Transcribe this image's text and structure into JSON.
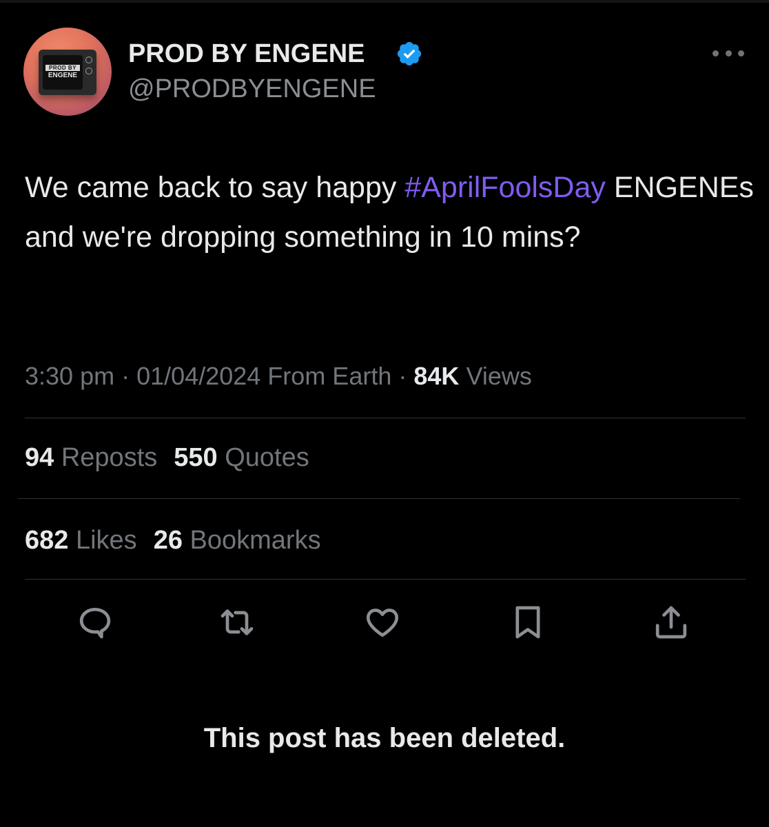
{
  "author": {
    "display_name": "PROD BY ENGENE",
    "handle": "@PRODBYENGENE",
    "avatar_logo_top": "PROD BY",
    "avatar_logo_main": "ENGENE",
    "verified": true,
    "verified_color": "#1d9bf0"
  },
  "tweet": {
    "text_before": "We came back to say happy ",
    "hashtag": "#AprilFoolsDay",
    "text_after": " ENGENEs and we're dropping something in 10 mins?",
    "hashtag_color": "#7f5cf0"
  },
  "meta": {
    "time": "3:30 pm",
    "separator": "·",
    "date": "01/04/2024",
    "source": "From Earth",
    "views_count": "84K",
    "views_label": "Views"
  },
  "stats": {
    "reposts_count": "94",
    "reposts_label": "Reposts",
    "quotes_count": "550",
    "quotes_label": "Quotes",
    "likes_count": "682",
    "likes_label": "Likes",
    "bookmarks_count": "26",
    "bookmarks_label": "Bookmarks"
  },
  "actions": [
    {
      "icon": "reply-icon"
    },
    {
      "icon": "retweet-icon"
    },
    {
      "icon": "heart-icon"
    },
    {
      "icon": "bookmark-icon"
    },
    {
      "icon": "share-icon"
    }
  ],
  "notice": "This post has been deleted.",
  "colors": {
    "background": "#000000",
    "primary_text": "#e7e9ea",
    "secondary_text": "#71767b",
    "divider": "#2f3336"
  }
}
